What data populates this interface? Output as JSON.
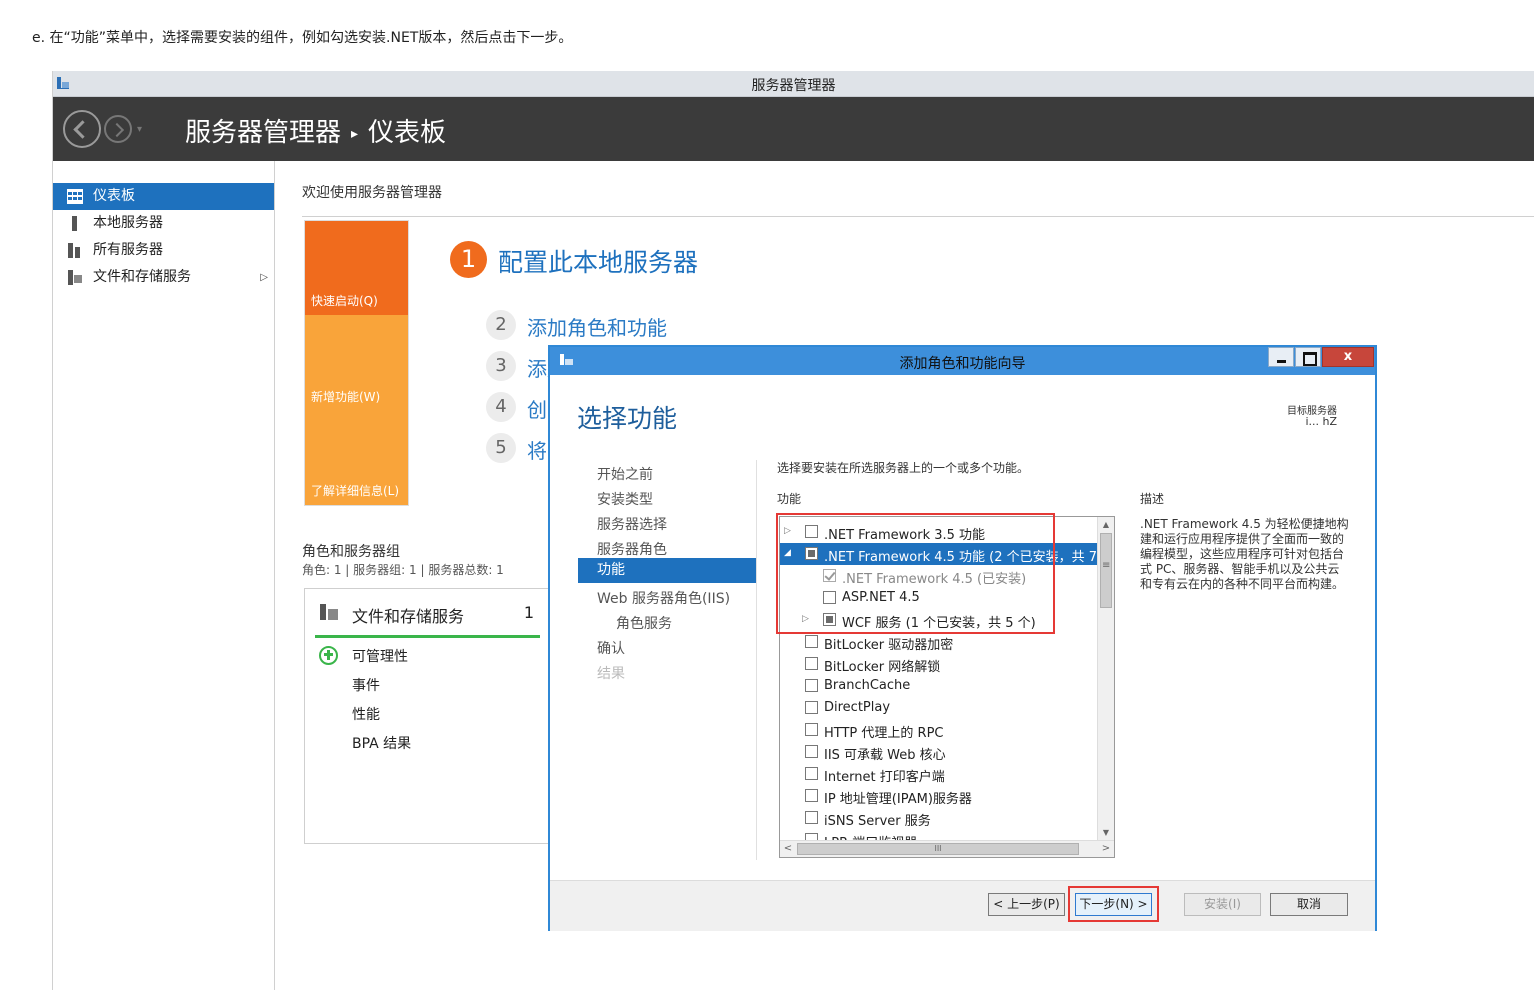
{
  "caption": "e. 在“功能”菜单中，选择需要安装的组件，例如勾选安装.NET版本，然后点击下一步。",
  "server_manager": {
    "window_title": "服务器管理器",
    "breadcrumb_root": "服务器管理器",
    "breadcrumb_sep": "▸",
    "breadcrumb_page": "仪表板",
    "sidebar": {
      "items": [
        {
          "label": "仪表板",
          "icon": "dashboard-icon",
          "active": true
        },
        {
          "label": "本地服务器",
          "icon": "local-server-icon"
        },
        {
          "label": "所有服务器",
          "icon": "all-servers-icon"
        },
        {
          "label": "文件和存储服务",
          "icon": "file-storage-icon",
          "chevron": "▷"
        }
      ]
    },
    "welcome": "欢迎使用服务器管理器",
    "tiles": {
      "quick_start": "快速启动(Q)",
      "whats_new": "新增功能(W)",
      "learn_more": "了解详细信息(L)"
    },
    "steps": [
      {
        "num": "1",
        "label": "配置此本地服务器"
      },
      {
        "num": "2",
        "label": "添加角色和功能"
      },
      {
        "num": "3",
        "label": "添加"
      },
      {
        "num": "4",
        "label": "创"
      },
      {
        "num": "5",
        "label": "将"
      }
    ],
    "roles_group": {
      "title": "角色和服务器组",
      "summary": "角色: 1 | 服务器组: 1 | 服务器总数: 1",
      "card_title": "文件和存储服务",
      "card_count": "1",
      "rows": [
        "可管理性",
        "事件",
        "性能",
        "BPA 结果"
      ]
    }
  },
  "wizard": {
    "title": "添加角色和功能向导",
    "close_label": "x",
    "heading": "选择功能",
    "target_label": "目标服务器",
    "target_value": "i...                hZ",
    "nav": [
      {
        "label": "开始之前"
      },
      {
        "label": "安装类型"
      },
      {
        "label": "服务器选择"
      },
      {
        "label": "服务器角色"
      },
      {
        "label": "功能",
        "active": true
      },
      {
        "label": "Web 服务器角色(IIS)"
      },
      {
        "label": "角色服务",
        "sub": true
      },
      {
        "label": "确认"
      },
      {
        "label": "结果",
        "disabled": true
      }
    ],
    "instruction": "选择要安装在所选服务器上的一个或多个功能。",
    "features_label": "功能",
    "description_label": "描述",
    "description": ".NET Framework 4.5 为轻松便捷地构建和运行应用程序提供了全面而一致的编程模型，这些应用程序可针对包括台式 PC、服务器、智能手机以及公共云和专有云在内的各种不同平台而构建。",
    "features": [
      {
        "label": ".NET Framework 3.5 功能",
        "state": "unchecked",
        "expander": "▷",
        "level": 0
      },
      {
        "label": ".NET Framework 4.5 功能 (2 个已安装，共 7 个)",
        "state": "partial",
        "expander": "◢",
        "level": 0,
        "selected": true
      },
      {
        "label": ".NET Framework 4.5 (已安装)",
        "state": "checked",
        "level": 1,
        "grey": true
      },
      {
        "label": "ASP.NET 4.5",
        "state": "unchecked",
        "level": 1
      },
      {
        "label": "WCF 服务 (1 个已安装，共 5 个)",
        "state": "partial",
        "expander": "▷",
        "level": 1
      },
      {
        "label": "BitLocker 驱动器加密",
        "state": "unchecked",
        "level": 0
      },
      {
        "label": "BitLocker 网络解锁",
        "state": "unchecked",
        "level": 0
      },
      {
        "label": "BranchCache",
        "state": "unchecked",
        "level": 0
      },
      {
        "label": "DirectPlay",
        "state": "unchecked",
        "level": 0
      },
      {
        "label": "HTTP 代理上的 RPC",
        "state": "unchecked",
        "level": 0
      },
      {
        "label": "IIS 可承载 Web 核心",
        "state": "unchecked",
        "level": 0
      },
      {
        "label": "Internet 打印客户端",
        "state": "unchecked",
        "level": 0
      },
      {
        "label": "IP 地址管理(IPAM)服务器",
        "state": "unchecked",
        "level": 0
      },
      {
        "label": "iSNS Server 服务",
        "state": "unchecked",
        "level": 0
      },
      {
        "label": "LPR 端口监视器",
        "state": "unchecked",
        "level": 0
      }
    ],
    "scroll": {
      "up": "▲",
      "down": "▼",
      "left": "<",
      "right": ">",
      "h_thumb": "III"
    },
    "buttons": {
      "prev": "< 上一步(P)",
      "next": "下一步(N) >",
      "install": "安装(I)",
      "cancel": "取消"
    }
  },
  "colors": {
    "accent": "#1e71be",
    "orange": "#f06b1d",
    "light_orange": "#f9a43a",
    "highlight_red": "#e53935",
    "header_dark": "#3b3b3b"
  }
}
